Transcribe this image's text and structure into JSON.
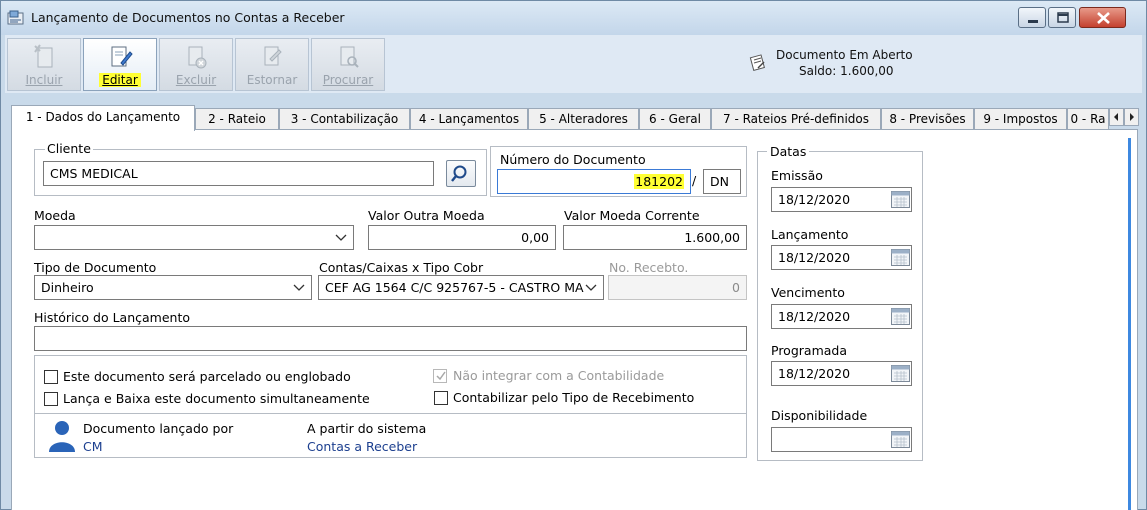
{
  "window": {
    "title": "Lançamento de Documentos no Contas a Receber"
  },
  "toolbar": {
    "incluir": "Incluir",
    "editar": "Editar",
    "excluir": "Excluir",
    "estornar": "Estornar",
    "procurar": "Procurar"
  },
  "status": {
    "line1": "Documento Em Aberto",
    "line2": "Saldo: 1.600,00"
  },
  "tabs": [
    "1 - Dados do Lançamento",
    "2 - Rateio",
    "3 - Contabilização",
    "4 - Lançamentos",
    "5 - Alteradores",
    "6 - Geral",
    "7 - Rateios Pré-definidos",
    "8 - Previsões",
    "9 - Impostos",
    "0 - Ra"
  ],
  "form": {
    "cliente_label": "Cliente",
    "cliente_value": "CMS MEDICAL",
    "numero_label": "Número do Documento",
    "numero_value": "181202",
    "numero_sep": "/",
    "numero_suffix": "DN",
    "moeda_label": "Moeda",
    "moeda_value": "",
    "valor_outra_label": "Valor Outra Moeda",
    "valor_outra_value": "0,00",
    "valor_corrente_label": "Valor Moeda Corrente",
    "valor_corrente_value": "1.600,00",
    "tipo_doc_label": "Tipo de Documento",
    "tipo_doc_value": "Dinheiro",
    "contas_label": "Contas/Caixas x Tipo Cobr",
    "contas_value": "CEF AG 1564 C/C 925767-5 - CASTRO MA",
    "recebto_label": "No. Recebto.",
    "recebto_value": "0",
    "historico_label": "Histórico do Lançamento",
    "historico_value": "",
    "chk_parcelado": "Este documento será parcelado ou englobado",
    "chk_nao_integrar": "Não integrar com a Contabilidade",
    "chk_lanca_baixa": "Lança e Baixa este documento simultaneamente",
    "chk_contabilizar": "Contabilizar pelo Tipo de Recebimento",
    "lancado_por_label": "Documento lançado por",
    "lancado_por_value": "CM",
    "sistema_label": "A partir do sistema",
    "sistema_value": "Contas a Receber"
  },
  "datas": {
    "group_label": "Datas",
    "emissao_label": "Emissão",
    "emissao_value": "18/12/2020",
    "lancamento_label": "Lançamento",
    "lancamento_value": "18/12/2020",
    "vencimento_label": "Vencimento",
    "vencimento_value": "18/12/2020",
    "programada_label": "Programada",
    "programada_value": "18/12/2020",
    "disponibilidade_label": "Disponibilidade",
    "disponibilidade_value": ""
  }
}
